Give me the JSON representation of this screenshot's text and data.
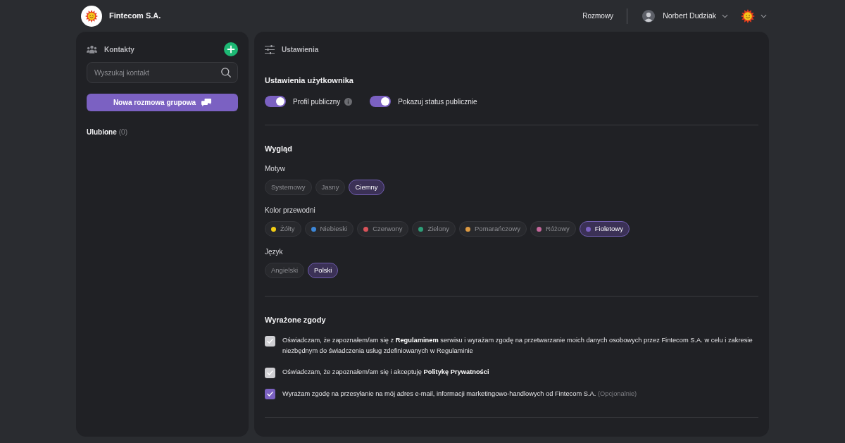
{
  "header": {
    "company": "Fintecom S.A.",
    "nav_link": "Rozmowy",
    "user_name": "Norbert Dudziak"
  },
  "contacts": {
    "title": "Kontakty",
    "search": {
      "placeholder": "Wyszukaj kontakt"
    },
    "new_group_button": "Nowa rozmowa grupowa",
    "favorites": {
      "label": "Ulubione",
      "count": "(0)"
    }
  },
  "settings": {
    "title": "Ustawienia",
    "user_settings": {
      "heading": "Ustawienia użytkownika",
      "toggles": [
        {
          "label": "Profil publiczny",
          "on": true,
          "info": true
        },
        {
          "label": "Pokazuj status publicznie",
          "on": true,
          "info": false
        }
      ]
    },
    "appearance": {
      "heading": "Wygląd",
      "groups": [
        {
          "label": "Motyw",
          "options": [
            {
              "label": "Systemowy",
              "selected": false
            },
            {
              "label": "Jasny",
              "selected": false
            },
            {
              "label": "Ciemny",
              "selected": true
            }
          ]
        },
        {
          "label": "Kolor przewodni",
          "options": [
            {
              "label": "Żółty",
              "color": "#f2cd14",
              "selected": false
            },
            {
              "label": "Niebieski",
              "color": "#3d87d8",
              "selected": false
            },
            {
              "label": "Czerwony",
              "color": "#d9535a",
              "selected": false
            },
            {
              "label": "Zielony",
              "color": "#2d9e78",
              "selected": false
            },
            {
              "label": "Pomarańczowy",
              "color": "#dd9a42",
              "selected": false
            },
            {
              "label": "Różowy",
              "color": "#c4679b",
              "selected": false
            },
            {
              "label": "Fioletowy",
              "color": "#7b61c2",
              "selected": true
            }
          ]
        },
        {
          "label": "Język",
          "options": [
            {
              "label": "Angielski",
              "selected": false
            },
            {
              "label": "Polski",
              "selected": true
            }
          ]
        }
      ]
    },
    "consents": {
      "heading": "Wyrażone zgody",
      "items": [
        {
          "text": "Oświadczam, że zapoznałem/am się z **Regulaminem** serwisu i wyrażam zgodę na przetwarzanie moich danych osobowych przez Fintecom S.A. w celu i zakresie niezbędnym do świadczenia usług zdefiniowanych w Regulaminie",
          "checked": true,
          "disabled": true
        },
        {
          "text": "Oświadczam, że zapoznałem/am się i akceptuję **Politykę Prywatności**",
          "checked": true,
          "disabled": true
        },
        {
          "text": "Wyrażam zgodę na przesyłanie na mój adres e-mail, informacji marketingowo-handlowych od Fintecom S.A.",
          "note": "(Opcjonalnie)",
          "checked": true,
          "disabled": false
        }
      ]
    }
  }
}
